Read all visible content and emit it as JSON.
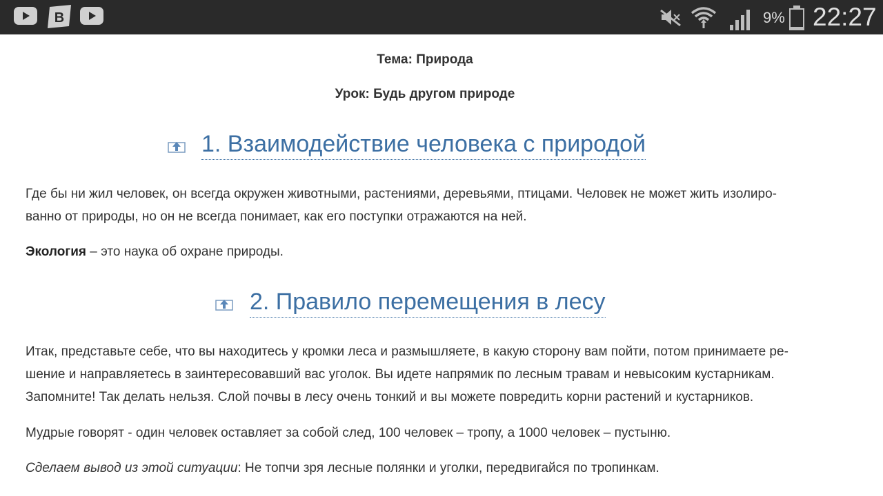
{
  "status_bar": {
    "apps": [
      "youtube-icon",
      "vk-icon",
      "youtube-icon"
    ],
    "battery_percent": "9%",
    "time": "22:27",
    "icons": [
      "mute-icon",
      "wifi-icon",
      "signal-icon",
      "battery-icon"
    ]
  },
  "article": {
    "topic": "Тема: Природа",
    "lesson": "Урок: Будь другом природе",
    "section1": {
      "title": "1. Взаимодействие человека с природой",
      "para1": "Где бы ни жил человек, он всегда окружен животными, растениями, деревьями, птицами. Человек не может жить изолированно от природы, но он не всегда понимает, как его поступки отражаются на ней.",
      "para1_line1": "Где бы ни жил человек, он всегда окружен животными, растениями, деревьями, птицами. Человек не может жить изолиро-",
      "para1_line2": "ванно от природы, но он не всегда понимает, как его поступки отражаются на ней.",
      "term": "Экология",
      "definition": " – это наука об охране природы."
    },
    "section2": {
      "title": "2.  Правило перемещения в лесу",
      "para1_line1": "Итак, представьте себе, что вы находитесь у кромки леса и размышляете, в какую сторону вам пойти, потом принимаете ре-",
      "para1_line2": "шение и направляетесь в заинтересовавший вас уголок. Вы идете напрямик по лесным травам и невысоким кустарникам.",
      "para1_line3": "Запомните! Так делать нельзя. Слой почвы в лесу очень тонкий и вы можете повредить корни растений и кустарников.",
      "para2": "Мудрые говорят - один человек оставляет за собой след, 100 человек – тропу, а 1000 человек – пустыню.",
      "conclusion_label": "Сделаем вывод из этой ситуации",
      "conclusion_text": ": Не топчи зря лесные полянки и уголки, передвигайся по тропинкам."
    }
  },
  "colors": {
    "status_bar_bg": "#2a2a2a",
    "heading_blue": "#3c6fa3",
    "body_text": "#333333"
  }
}
